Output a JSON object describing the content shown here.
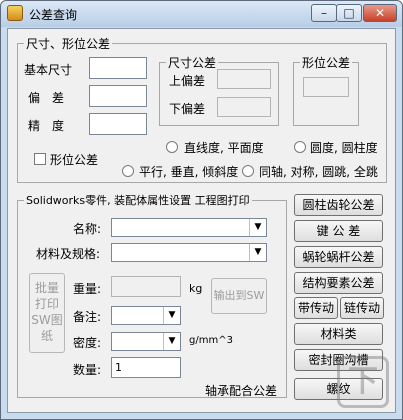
{
  "window": {
    "title": "公差查询",
    "minimize": "–",
    "maximize": "□",
    "close": "✕"
  },
  "tolerance_group": {
    "title": "尺寸、形位公差",
    "nominal_size_label": "基本尺寸",
    "deviation_label": "偏　差",
    "precision_label": "精　度",
    "size_tolerance_title": "尺寸公差",
    "upper_deviation_label": "上偏差",
    "lower_deviation_label": "下偏差",
    "form_tolerance_title": "形位公差",
    "form_tolerance_checkbox": "形位公差",
    "radios": [
      "直线度, 平面度",
      "圆度, 圆柱度",
      "平行, 垂直, 倾斜度",
      "同轴, 对称, 圆跳, 全跳"
    ]
  },
  "sw_group": {
    "title": "Solidworks零件, 装配体属性设置 工程图打印",
    "name_label": "名称:",
    "material_label": "材料及规格:",
    "weight_label": "重量:",
    "weight_unit": "kg",
    "note_label": "备注:",
    "density_label": "密度:",
    "density_unit": "g/mm^3",
    "quantity_label": "数量:",
    "quantity_value": "1",
    "print_button": "批量打印SW图纸",
    "output_button": "输出到SW"
  },
  "right_buttons": [
    "圆柱齿轮公差",
    "键 公 差",
    "蜗轮蜗杆公差",
    "结构要素公差"
  ],
  "small_buttons": [
    "带传动",
    "链传动"
  ],
  "bottom_buttons": [
    "材料类",
    "密封圈沟槽",
    "螺纹"
  ],
  "bearing_label": "轴承配合公差",
  "watermark": "下"
}
